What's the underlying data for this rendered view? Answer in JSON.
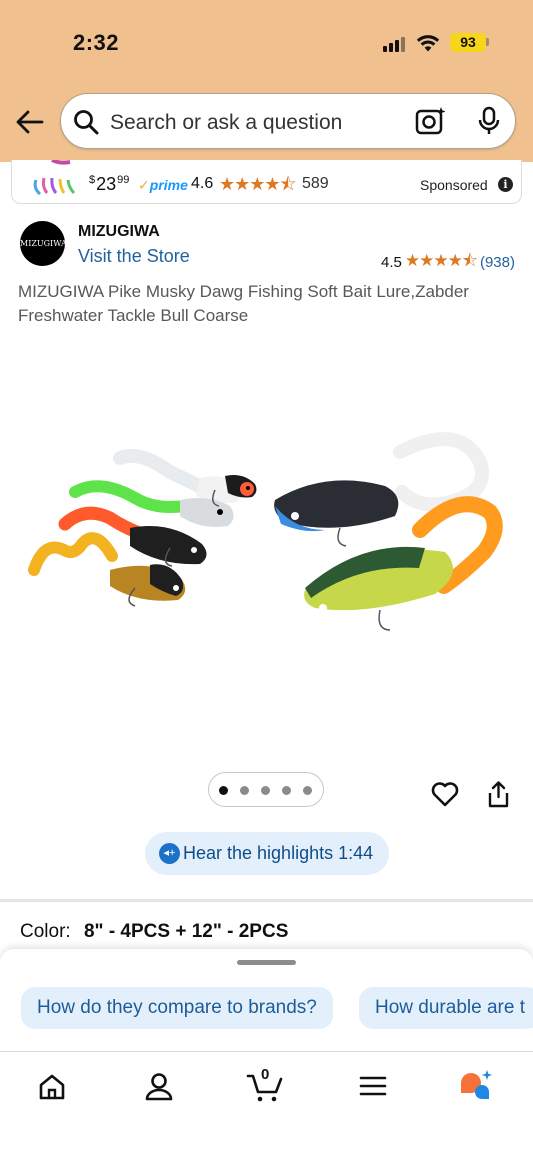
{
  "status_bar": {
    "time": "2:32",
    "battery": "93"
  },
  "search": {
    "placeholder": "Search or ask a question"
  },
  "sponsored": {
    "price_symbol": "$",
    "price_whole": "23",
    "price_fraction": "99",
    "prime_label": "prime",
    "rating": "4.6",
    "rating_count": "589",
    "label": "Sponsored",
    "rating_stars": 4.5
  },
  "brand": {
    "logo_text": "MIZUGIWA",
    "name": "MIZUGIWA",
    "store_link": "Visit the Store",
    "rating": "4.5",
    "rating_count": "(938)",
    "rating_stars": 4.5
  },
  "product": {
    "title": "MIZUGIWA Pike Musky Dawg Fishing Soft Bait Lure,Zabder Freshwater Tackle Bull Coarse"
  },
  "carousel": {
    "total_dots": 5,
    "active_index": 0
  },
  "highlights": {
    "label": "Hear the highlights 1:44"
  },
  "color": {
    "label": "Color:",
    "value": "8\" - 4PCS + 12\" - 2PCS"
  },
  "rufus": {
    "chips": [
      "How do they compare to brands?",
      "How durable are t"
    ]
  },
  "bottom_nav": {
    "cart_count": "0",
    "items": [
      "home-icon",
      "account-icon",
      "cart-icon",
      "menu-icon",
      "rufus-icon"
    ]
  },
  "colors": {
    "header_bg": "#f0c18f",
    "link": "#2162a1",
    "star": "#de7921",
    "chip_bg": "#e3f0fb"
  }
}
